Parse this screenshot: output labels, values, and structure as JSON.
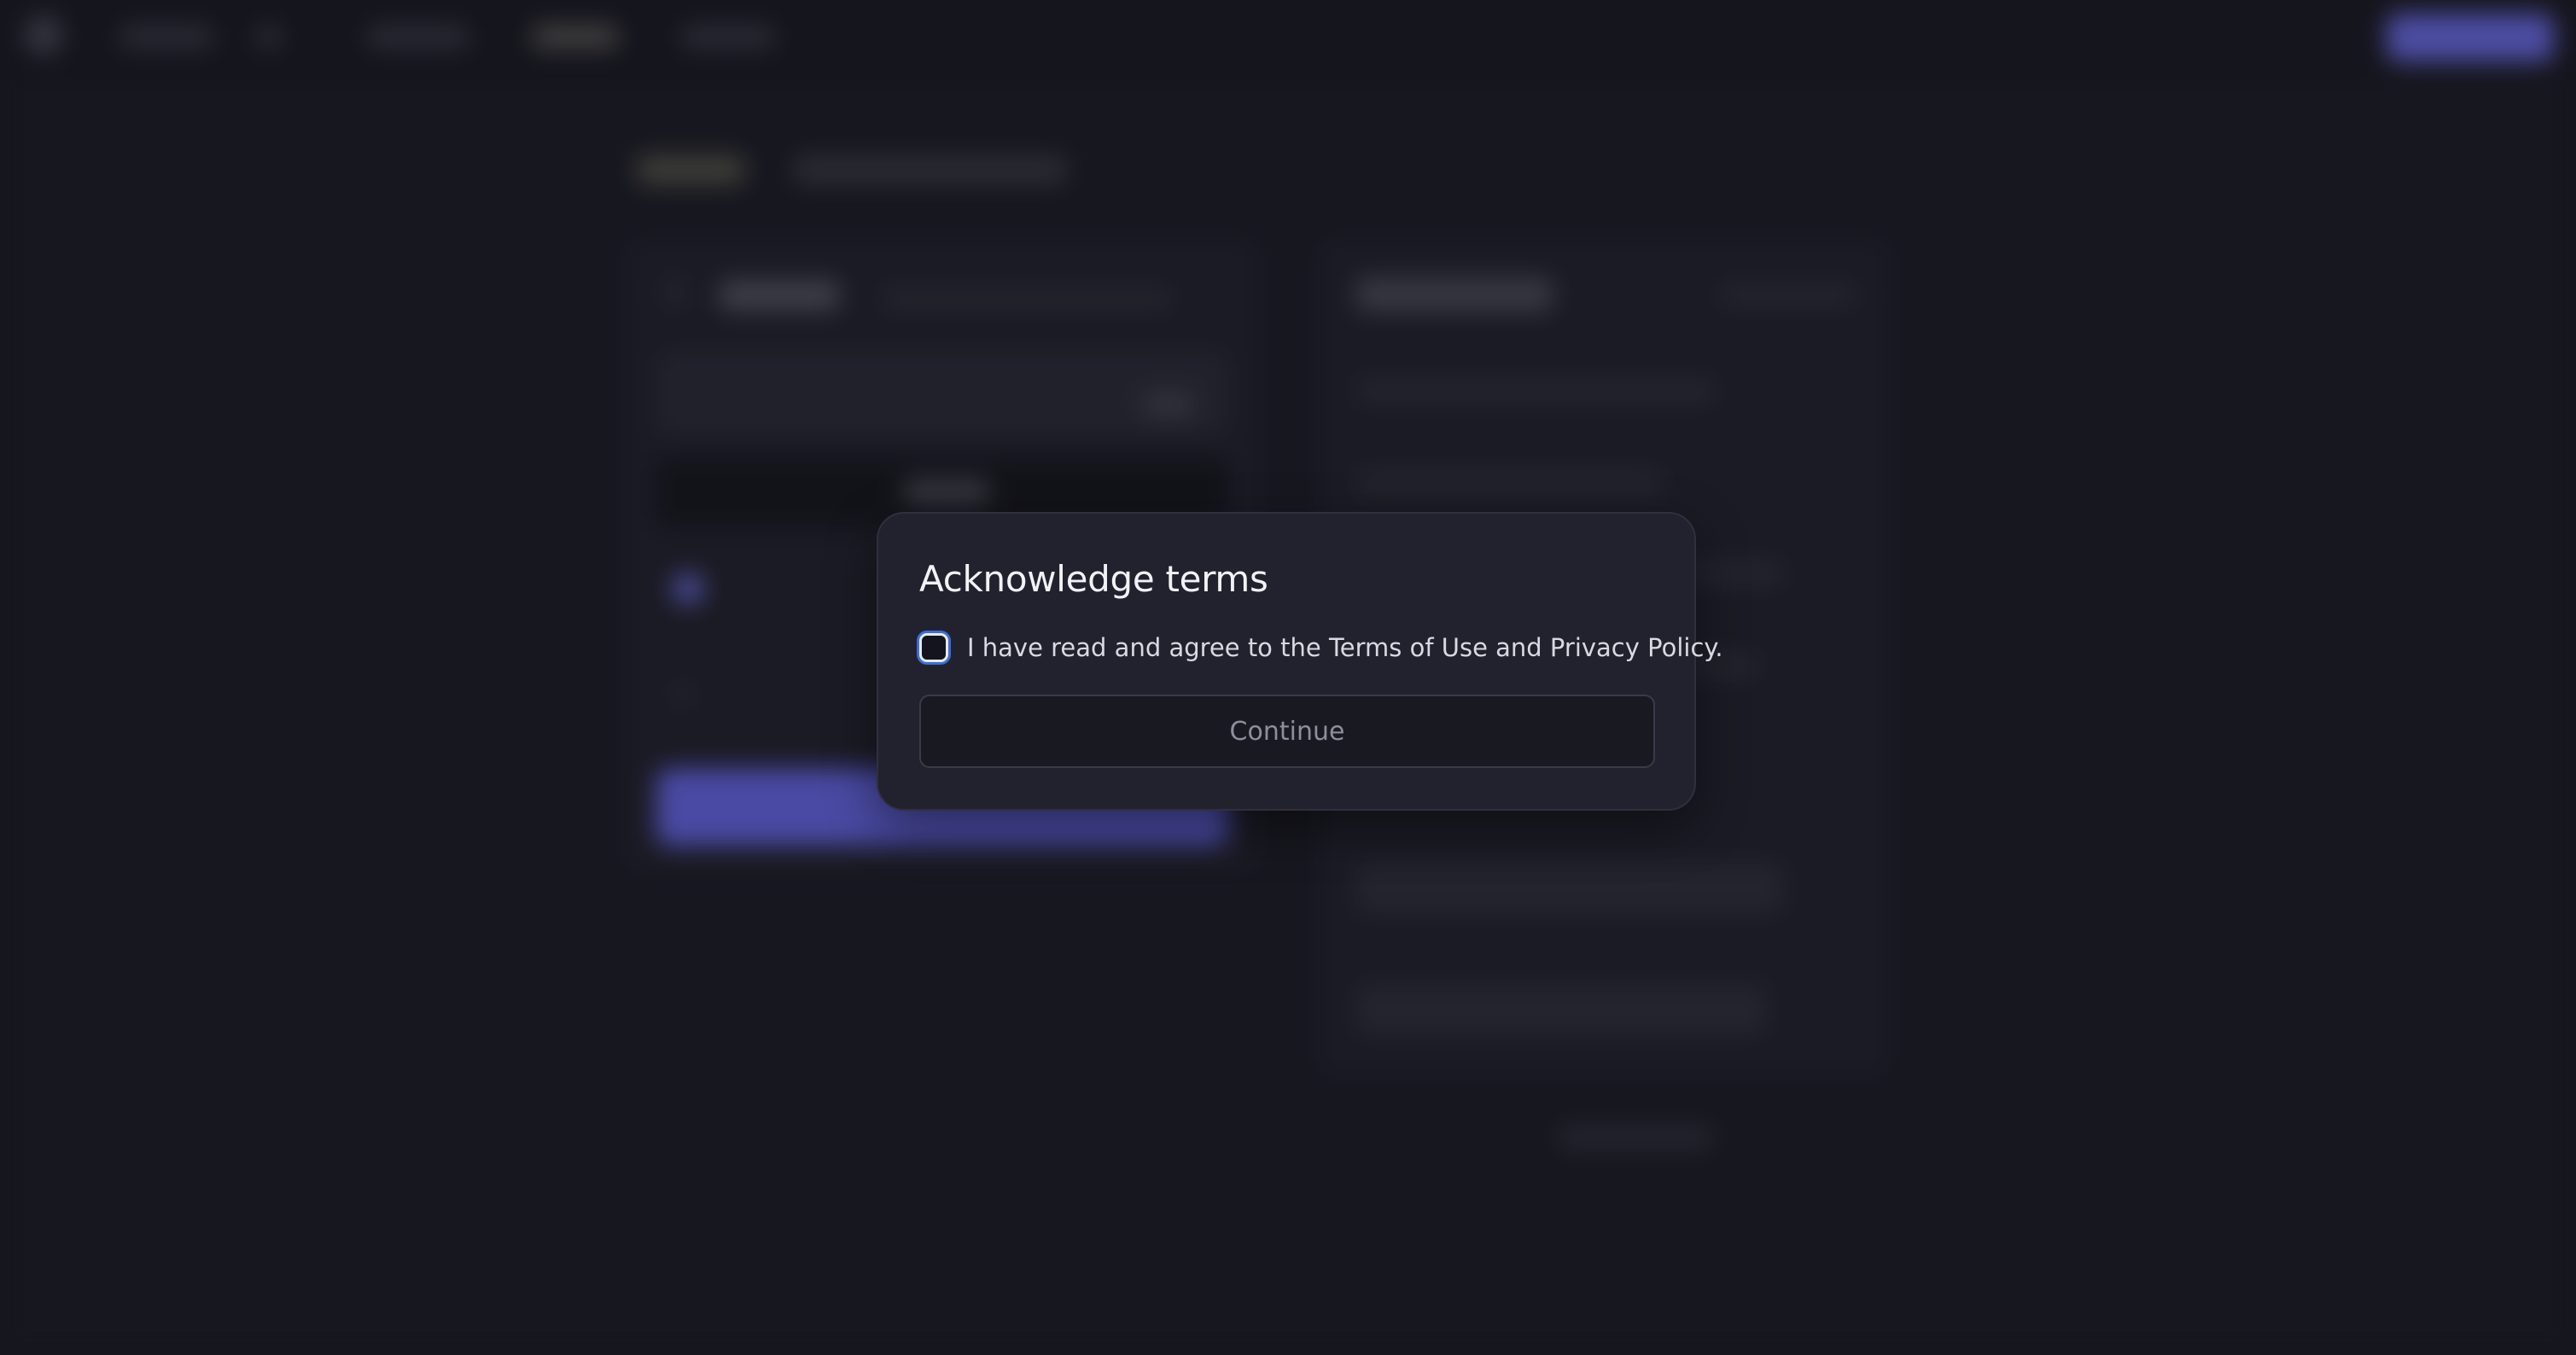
{
  "modal": {
    "title": "Acknowledge terms",
    "agreement": {
      "label": "I have read and agree to the Terms of Use and Privacy Policy.",
      "checked": false
    },
    "continue_button": {
      "label": "Continue",
      "disabled": true
    }
  },
  "colors": {
    "background": "#1c1c26",
    "modal_background": "#22222f",
    "accent": "#6a6af2",
    "checkbox_focus_ring": "#3b6fd8"
  }
}
